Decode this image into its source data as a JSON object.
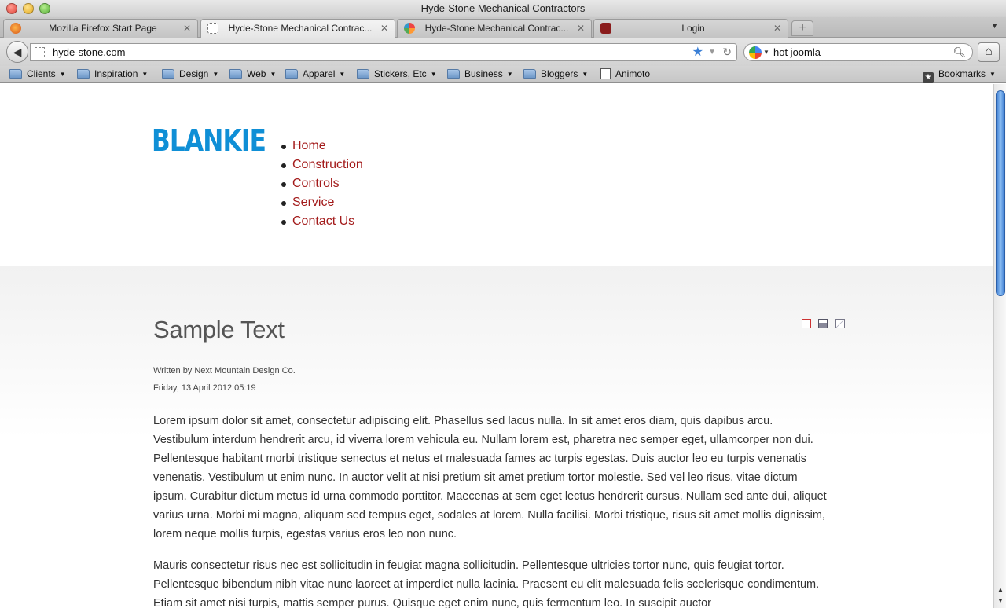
{
  "window": {
    "title": "Hyde-Stone Mechanical Contractors"
  },
  "tabs": [
    {
      "label": "Mozilla Firefox Start Page",
      "favicon": "firefox-icon"
    },
    {
      "label": "Hyde-Stone Mechanical Contrac...",
      "favicon": "blank-page-icon",
      "active": true
    },
    {
      "label": "Hyde-Stone Mechanical Contrac...",
      "favicon": "joomla-icon"
    },
    {
      "label": "Login",
      "favicon": "login-icon"
    }
  ],
  "toolbar": {
    "url": "hyde-stone.com",
    "search_value": "hot joomla"
  },
  "bookmarks": {
    "folders": [
      "Clients",
      "Inspiration",
      "Design",
      "Web",
      "Apparel",
      "Stickers, Etc",
      "Business",
      "Bloggers"
    ],
    "link": "Animoto",
    "menu": "Bookmarks"
  },
  "site": {
    "logo_text": "BLANKIE",
    "logo_color": "#0f8fd6",
    "link_color": "#a31b1b",
    "nav": [
      "Home",
      "Construction",
      "Controls",
      "Service",
      "Contact Us"
    ]
  },
  "article": {
    "title": "Sample Text",
    "author": "Written by Next Mountain Design Co.",
    "date": "Friday, 13 April 2012 05:19",
    "paragraphs": [
      "Lorem ipsum dolor sit amet, consectetur adipiscing elit. Phasellus sed lacus nulla. In sit amet eros diam, quis dapibus arcu. Vestibulum interdum hendrerit arcu, id viverra lorem vehicula eu. Nullam lorem est, pharetra nec semper eget, ullamcorper non dui. Pellentesque habitant morbi tristique senectus et netus et malesuada fames ac turpis egestas. Duis auctor leo eu turpis venenatis venenatis. Vestibulum ut enim nunc. In auctor velit at nisi pretium sit amet pretium tortor molestie. Sed vel leo risus, vitae dictum ipsum. Curabitur dictum metus id urna commodo porttitor. Maecenas at sem eget lectus hendrerit cursus. Nullam sed ante dui, aliquet varius urna. Morbi mi magna, aliquam sed tempus eget, sodales at lorem. Nulla facilisi. Morbi tristique, risus sit amet mollis dignissim, lorem neque mollis turpis, egestas varius eros leo non nunc.",
      "Mauris consectetur risus nec est sollicitudin in feugiat magna sollicitudin. Pellentesque ultricies tortor nunc, quis feugiat tortor. Pellentesque bibendum nibh vitae nunc laoreet at imperdiet nulla lacinia. Praesent eu elit malesuada felis scelerisque condimentum. Etiam sit amet nisi turpis, mattis semper purus. Quisque eget enim nunc, quis fermentum leo. In suscipit auctor"
    ]
  }
}
